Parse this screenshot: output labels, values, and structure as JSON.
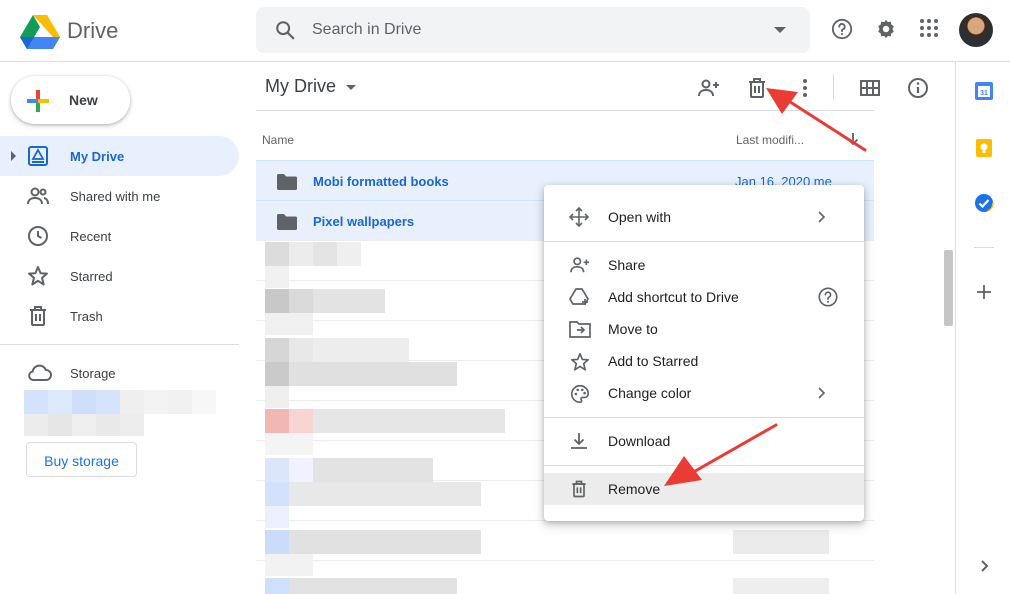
{
  "app": {
    "name": "Drive"
  },
  "search": {
    "placeholder": "Search in Drive"
  },
  "sidebar": {
    "new_label": "New",
    "items": [
      {
        "label": "My Drive",
        "icon": "my-drive-icon",
        "active": true
      },
      {
        "label": "Shared with me",
        "icon": "people-icon"
      },
      {
        "label": "Recent",
        "icon": "clock-icon"
      },
      {
        "label": "Starred",
        "icon": "star-icon"
      },
      {
        "label": "Trash",
        "icon": "trash-icon"
      }
    ],
    "storage_label": "Storage",
    "buy_storage_label": "Buy storage"
  },
  "main": {
    "title": "My Drive",
    "columns": {
      "name": "Name",
      "modified": "Last modifi..."
    },
    "rows": [
      {
        "name": "Mobi formatted books",
        "modified": "Jan 16, 2020  me",
        "selected": true
      },
      {
        "name": "Pixel wallpapers",
        "modified": "",
        "selected": true
      }
    ]
  },
  "context_menu": {
    "items": [
      {
        "label": "Open with",
        "icon": "move-arrows-icon",
        "submenu": true
      },
      {
        "label": "Share",
        "icon": "add-person-icon"
      },
      {
        "label": "Add shortcut to Drive",
        "icon": "shortcut-drive-icon",
        "help": true
      },
      {
        "label": "Move to",
        "icon": "move-folder-icon"
      },
      {
        "label": "Add to Starred",
        "icon": "star-icon"
      },
      {
        "label": "Change color",
        "icon": "palette-icon",
        "submenu": true
      },
      {
        "label": "Download",
        "icon": "download-icon"
      },
      {
        "label": "Remove",
        "icon": "trash-icon",
        "highlighted": true
      }
    ]
  },
  "colors": {
    "accent": "#1967d2",
    "selected_bg": "#e8f0fe",
    "annotation_arrow": "#ea3b35"
  }
}
